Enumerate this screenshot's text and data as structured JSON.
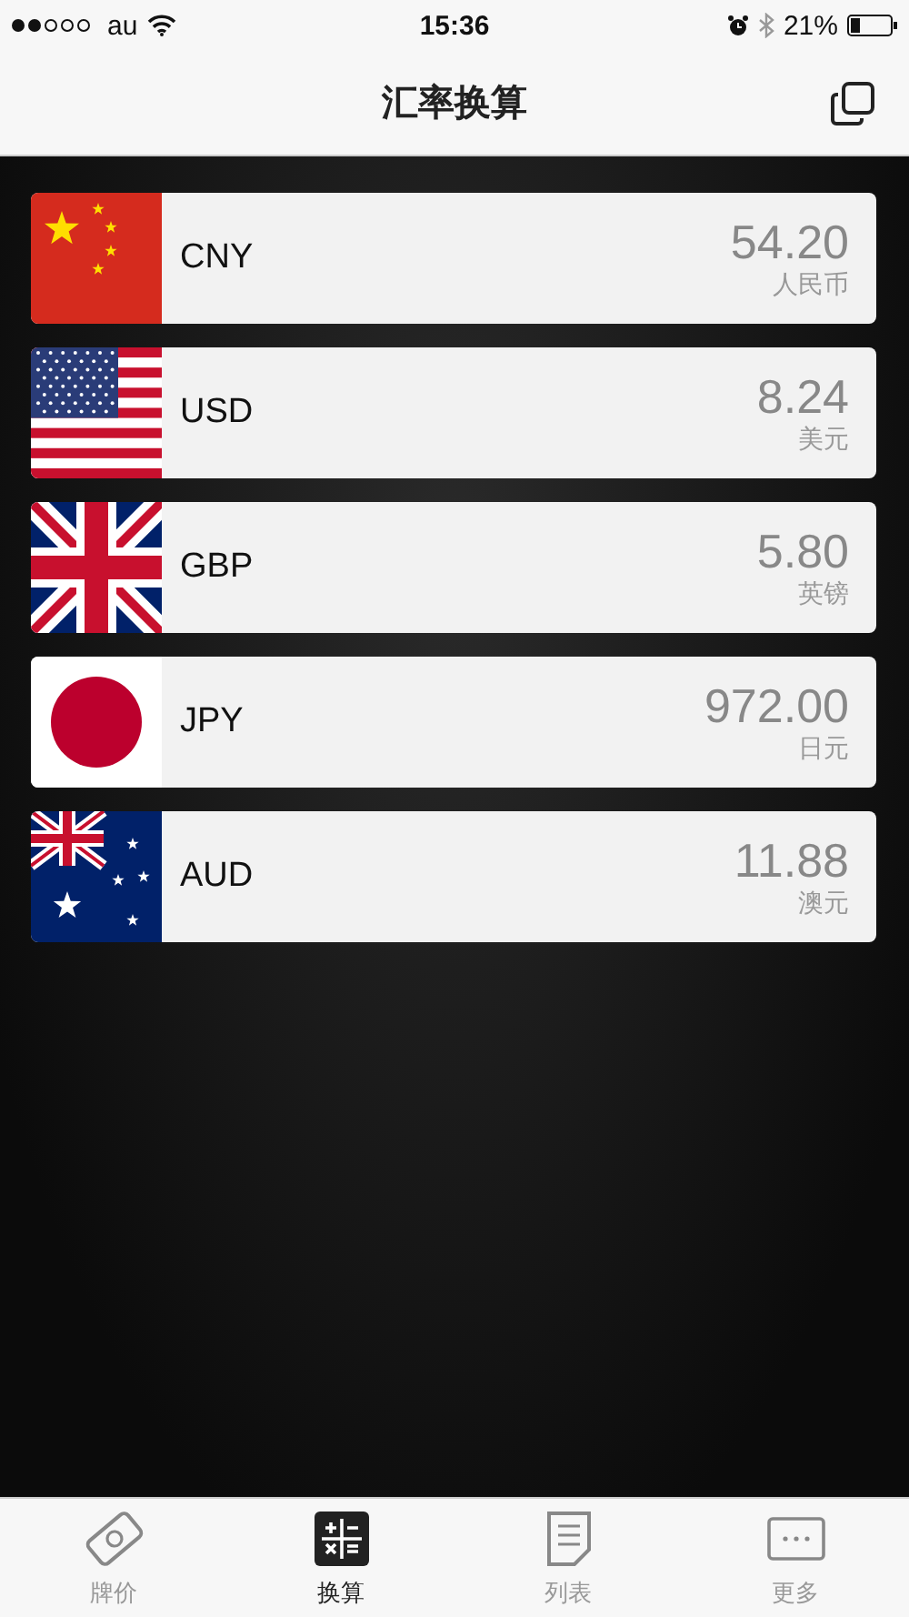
{
  "status_bar": {
    "carrier": "au",
    "time": "15:36",
    "battery": "21%"
  },
  "nav": {
    "title": "汇率换算"
  },
  "currencies": [
    {
      "kind": "cn",
      "code": "CNY",
      "amount": "54.20",
      "name": "人民币"
    },
    {
      "kind": "us",
      "code": "USD",
      "amount": "8.24",
      "name": "美元"
    },
    {
      "kind": "gb",
      "code": "GBP",
      "amount": "5.80",
      "name": "英镑"
    },
    {
      "kind": "jp",
      "code": "JPY",
      "amount": "972.00",
      "name": "日元"
    },
    {
      "kind": "au",
      "code": "AUD",
      "amount": "11.88",
      "name": "澳元"
    }
  ],
  "tabs": [
    {
      "kind": "tag",
      "label": "牌价",
      "selected": false
    },
    {
      "kind": "calculator",
      "label": "换算",
      "selected": true
    },
    {
      "kind": "document",
      "label": "列表",
      "selected": false
    },
    {
      "kind": "more",
      "label": "更多",
      "selected": false
    }
  ]
}
